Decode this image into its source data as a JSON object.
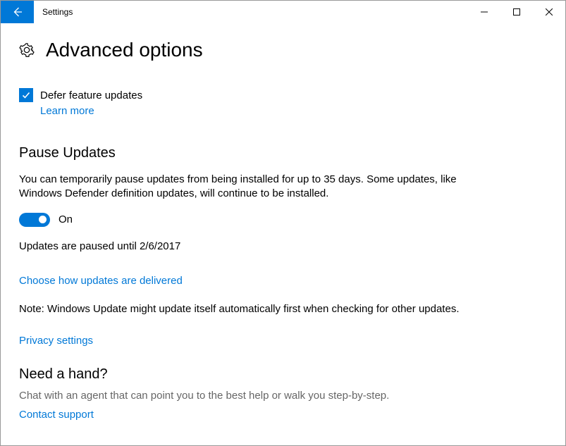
{
  "window": {
    "title": "Settings"
  },
  "page": {
    "heading": "Advanced options"
  },
  "defer": {
    "label": "Defer feature updates",
    "learn_more": "Learn more"
  },
  "pause": {
    "heading": "Pause Updates",
    "description": "You can temporarily pause updates from being installed for up to 35 days. Some updates, like Windows Defender definition updates, will continue to be installed.",
    "toggle_label": "On",
    "paused_until": "Updates are paused until 2/6/2017"
  },
  "links": {
    "delivery": "Choose how updates are delivered",
    "note": "Note: Windows Update might update itself automatically first when checking for other updates.",
    "privacy": "Privacy settings"
  },
  "help": {
    "heading": "Need a hand?",
    "body": "Chat with an agent that can point you to the best help or walk you step-by-step.",
    "contact": "Contact support"
  }
}
